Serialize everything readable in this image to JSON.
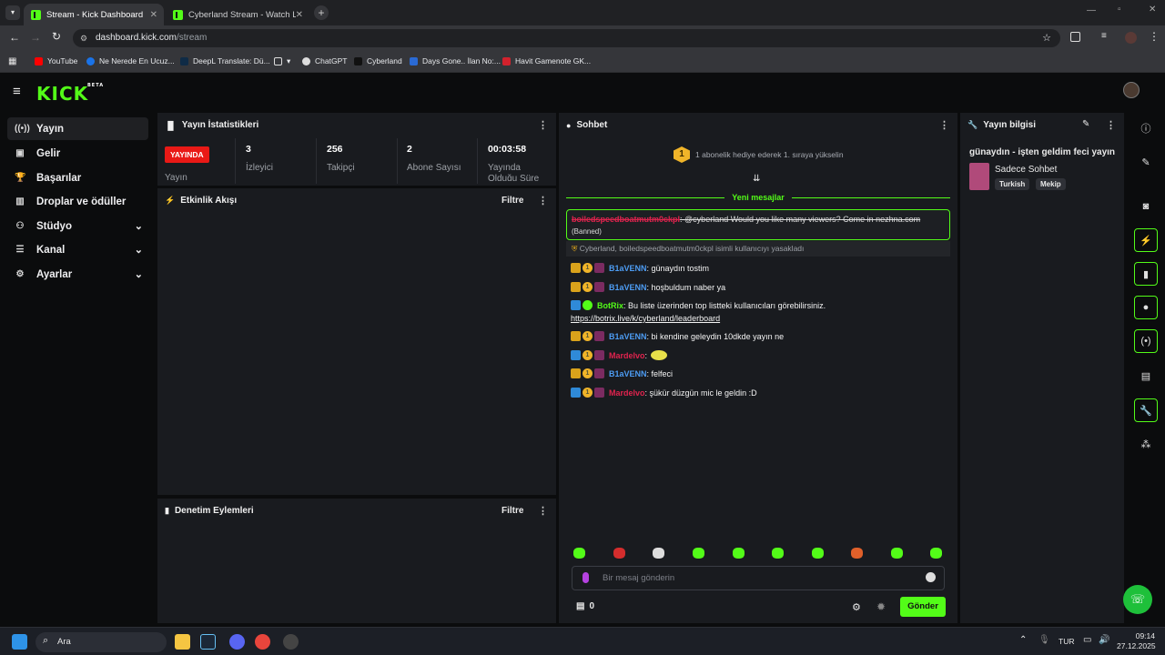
{
  "browser": {
    "tabs": [
      {
        "title": "Stream - Kick Dashboard",
        "active": true
      },
      {
        "title": "Cyberland Stream - Watch Live",
        "active": false
      }
    ],
    "url_host": "dashboard.kick.com",
    "url_path": "/stream",
    "bookmarks": [
      "YouTube",
      "Ne Nerede En Ucuz...",
      "DeepL Translate: Dü...",
      "ChatGPT",
      "Cyberland",
      "Days Gone.. İlan No:...",
      "Havit Gamenote GK..."
    ]
  },
  "kick": {
    "logo": "KICK",
    "logo_sup": "BETA"
  },
  "sidebar": {
    "items": [
      {
        "label": "Yayın",
        "icon": "broadcast-icon"
      },
      {
        "label": "Gelir",
        "icon": "revenue-icon"
      },
      {
        "label": "Başarılar",
        "icon": "trophy-icon"
      },
      {
        "label": "Droplar ve ödüller",
        "icon": "gift-icon"
      },
      {
        "label": "Stüdyo",
        "icon": "studio-icon"
      },
      {
        "label": "Kanal",
        "icon": "channel-icon"
      },
      {
        "label": "Ayarlar",
        "icon": "settings-icon"
      }
    ]
  },
  "stats": {
    "title": "Yayın İstatistikleri",
    "live_badge": "YAYINDA",
    "live_label": "Yayın",
    "viewers": "3",
    "viewers_label": "İzleyici",
    "followers": "256",
    "followers_label": "Takipçi",
    "subs": "2",
    "subs_label": "Abone Sayısı",
    "duration": "00:03:58",
    "duration_label": "Yayında Olduğu Süre"
  },
  "activity": {
    "title": "Etkinlik Akışı",
    "filter": "Filtre"
  },
  "moderation": {
    "title": "Denetim Eylemleri",
    "filter": "Filtre"
  },
  "chat": {
    "title": "Sohbet",
    "gift_banner": "1 abonelik hediye ederek 1. sıraya yükselin",
    "gift_count": "1",
    "new_messages": "Yeni mesajlar",
    "banned_user": "boiledspeedboatmutm0ckpl",
    "banned_text": "@cyberland Would you like many viewers? Come in nezhna.com",
    "banned_tag": "(Banned)",
    "ban_notice": "Cyberland, boiledspeedboatmutm0ckpl isimli kullanıcıyı yasakladı",
    "messages": [
      {
        "user": "B1aVENN",
        "text": ": günaydın tostim"
      },
      {
        "user": "B1aVENN",
        "text": ": hoşbuldum naber ya"
      },
      {
        "user": "BotRix",
        "text": ": Bu liste üzerinden top listteki kullanıcıları görebilirsiniz.",
        "link": "https://botrix.live/k/cyberland/leaderboard"
      },
      {
        "user": "B1aVENN",
        "text": ": bi kendine geleydin 10dkde yayın ne"
      },
      {
        "user": "Mardelvo",
        "text": ":"
      },
      {
        "user": "B1aVENN",
        "text": ": felfeci"
      },
      {
        "user": "Mardelvo",
        "text": ": şükür düzgün mic le geldin :D"
      }
    ],
    "input_placeholder": "Bir mesaj gönderin",
    "points": "0",
    "send": "Gönder"
  },
  "stream_info": {
    "title": "Yayın bilgisi",
    "stream_title": "günaydın - işten geldim feci yayın",
    "category": "Sadece Sohbet",
    "tags": [
      "Turkish",
      "Mekip"
    ]
  },
  "taskbar": {
    "search": "Ara",
    "lang": "TUR",
    "time": "09:14",
    "date": "27.12.2025"
  },
  "colors": {
    "brand": "#53fc18",
    "live": "#e91916",
    "panel": "#191b1f"
  }
}
